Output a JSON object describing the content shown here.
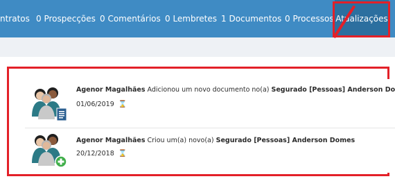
{
  "tabs": [
    {
      "label": "ntratos"
    },
    {
      "label": "0 Prospecções"
    },
    {
      "label": "0 Comentários"
    },
    {
      "label": "0 Lembretes"
    },
    {
      "label": "1 Documentos"
    },
    {
      "label": "0 Processos"
    },
    {
      "label": "Atualizações",
      "active": true
    }
  ],
  "feed": {
    "items": [
      {
        "user": "Agenor Magalhães",
        "action": "Adicionou um novo documento no(a)",
        "target": "Segurado [Pessoas] Anderson Domes",
        "date": "01/06/2019",
        "avatar_icon": "users-document-icon",
        "status_icon": "hourglass-icon"
      },
      {
        "user": "Agenor Magalhães",
        "action": "Criou um(a) novo(a)",
        "target": "Segurado [Pessoas] Anderson Domes",
        "date": "20/12/2018",
        "avatar_icon": "users-add-icon",
        "status_icon": "hourglass-icon"
      }
    ]
  },
  "colors": {
    "tabbar": "#3f8bc4",
    "tab_active": "#2c6f9f",
    "annotation": "#e32028",
    "subbar": "#eef1f5"
  }
}
